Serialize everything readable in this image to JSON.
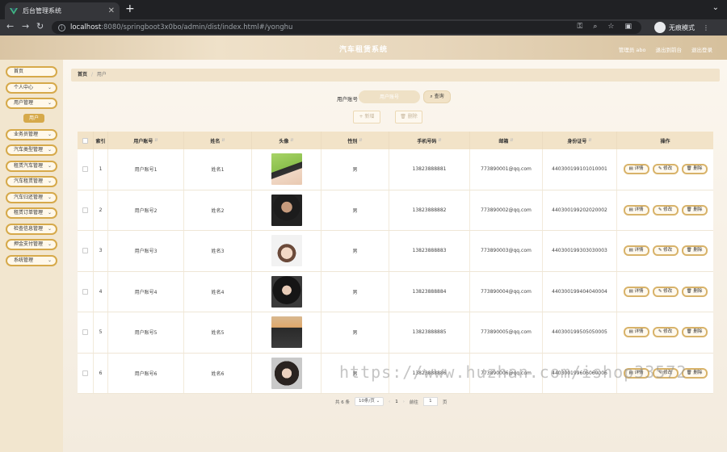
{
  "browser": {
    "tab_title": "后台管理系统",
    "new_tab": "+",
    "tab_menu": "⌄",
    "url_host": "localhost",
    "url_rest": ":8080/springboot3x0bo/admin/dist/index.html#/yonghu",
    "incognito_label": "无痕模式"
  },
  "header": {
    "title": "汽车租赁系统",
    "admin_label": "管理员 abo",
    "back_home": "退出到前台",
    "logout": "退出登录"
  },
  "sidebar": {
    "items": [
      {
        "label": "首页",
        "arrow": ""
      },
      {
        "label": "个人中心",
        "arrow": "⌄"
      },
      {
        "label": "用户管理",
        "arrow": "⌄"
      },
      {
        "label": "业务员管理",
        "arrow": "⌄"
      },
      {
        "label": "汽车类型管理",
        "arrow": "⌄"
      },
      {
        "label": "租赁汽车管理",
        "arrow": "⌄"
      },
      {
        "label": "汽车租赁管理",
        "arrow": "⌄"
      },
      {
        "label": "汽车归还管理",
        "arrow": "⌄"
      },
      {
        "label": "租赁订单管理",
        "arrow": "⌄"
      },
      {
        "label": "检查信息管理",
        "arrow": "⌄"
      },
      {
        "label": "押金支付管理",
        "arrow": "⌄"
      },
      {
        "label": "系统管理",
        "arrow": "⌄"
      }
    ],
    "sub_item": "用户"
  },
  "breadcrumb": {
    "home": "首页",
    "sep": "/",
    "current": "用户"
  },
  "search": {
    "label": "用户账号",
    "placeholder": "用户账号",
    "button": "查询"
  },
  "actions": {
    "add": "新增",
    "delete": "删除"
  },
  "table": {
    "headers": [
      "索引",
      "用户账号",
      "姓名",
      "头像",
      "性别",
      "手机号码",
      "邮箱",
      "身份证号",
      "操作"
    ],
    "sort_mark": "⇵",
    "rows": [
      {
        "index": "1",
        "account": "用户账号1",
        "name": "姓名1",
        "gender": "男",
        "phone": "13823888881",
        "email": "773890001@qq.com",
        "id_card": "440300199101010001"
      },
      {
        "index": "2",
        "account": "用户账号2",
        "name": "姓名2",
        "gender": "男",
        "phone": "13823888882",
        "email": "773890002@qq.com",
        "id_card": "440300199202020002"
      },
      {
        "index": "3",
        "account": "用户账号3",
        "name": "姓名3",
        "gender": "男",
        "phone": "13823888883",
        "email": "773890003@qq.com",
        "id_card": "440300199303030003"
      },
      {
        "index": "4",
        "account": "用户账号4",
        "name": "姓名4",
        "gender": "男",
        "phone": "13823888884",
        "email": "773890004@qq.com",
        "id_card": "440300199404040004"
      },
      {
        "index": "5",
        "account": "用户账号5",
        "name": "姓名5",
        "gender": "男",
        "phone": "13823888885",
        "email": "773890005@qq.com",
        "id_card": "440300199505050005"
      },
      {
        "index": "6",
        "account": "用户账号6",
        "name": "姓名6",
        "gender": "男",
        "phone": "13823888886",
        "email": "773890006@qq.com",
        "id_card": "440300199606060006"
      }
    ],
    "op_detail": "详情",
    "op_edit": "修改",
    "op_delete": "删除"
  },
  "pagination": {
    "total": "共 6 条",
    "page_size": "10条/页",
    "prev": "‹",
    "page": "1",
    "next": "›",
    "goto": "前往",
    "goto_value": "1",
    "page_unit": "页"
  },
  "watermark": "https://www.huzhan.com/ishop33572",
  "colors": {
    "accent": "#d6a94a",
    "header_bg": "#efe1c9",
    "table_head": "#f2e3c8"
  }
}
